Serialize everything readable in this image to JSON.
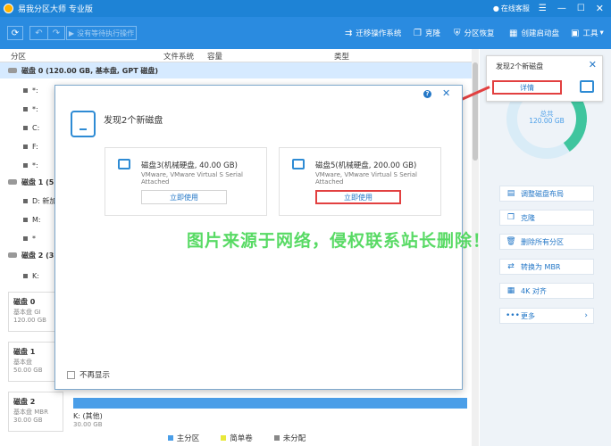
{
  "app": {
    "title": "易我分区大师 专业版",
    "support": "在线客服"
  },
  "toolbar": {
    "exec_label": "没有等待执行操作",
    "migrate_os": "迁移操作系统",
    "clone": "克隆",
    "recovery": "分区恢复",
    "boot_disk": "创建启动盘",
    "tools": "工具"
  },
  "table": {
    "headers": {
      "partition": "分区",
      "filesystem": "文件系统",
      "capacity": "容量",
      "type": "类型"
    }
  },
  "tree": {
    "disk0": "磁盘 0 (120.00 GB, 基本盘, GPT 磁盘)",
    "disk1": "磁盘 1 (5",
    "disk2": "磁盘 2 (3",
    "parts": [
      "*:",
      "*:",
      "C:",
      "F:",
      "*:",
      "D: 新加",
      "M:",
      "*",
      "K:"
    ]
  },
  "disk_cards": [
    {
      "name": "磁盘 0",
      "type": "基本盘 GI",
      "size": "120.00 GB"
    },
    {
      "name": "磁盘 1",
      "type": "基本盘",
      "size": "50.00 GB"
    },
    {
      "name": "磁盘 2",
      "type": "基本盘 MBR",
      "size": "30.00 GB"
    }
  ],
  "disk2_partition": {
    "label": "K: (其他)",
    "size": "30.00 GB"
  },
  "legend": [
    "主分区",
    "简单卷",
    "未分配"
  ],
  "right_panel": {
    "total_label": "总共",
    "total_value": "120.00 GB",
    "actions": [
      "调整磁盘布局",
      "克隆",
      "删除所有分区",
      "转换为 MBR",
      "4K 对齐",
      "更多"
    ]
  },
  "notify": {
    "title": "发现2个新磁盘",
    "button": "详情"
  },
  "dialog": {
    "title": "发现2个新磁盘",
    "cards": [
      {
        "name": "磁盘3(机械硬盘, 40.00 GB)",
        "model": "VMware, VMware Virtual S Serial Attached",
        "button": "立即使用"
      },
      {
        "name": "磁盘5(机械硬盘, 200.00 GB)",
        "model": "VMware, VMware Virtual S Serial Attached",
        "button": "立即使用"
      }
    ],
    "no_show": "不再显示"
  },
  "watermark": "图片来源于网络，侵权联系站长删除！",
  "colors": {
    "brand": "#1e83d6",
    "accent": "#2377c7",
    "highlight": "#e24040",
    "watermark": "#46d654"
  }
}
